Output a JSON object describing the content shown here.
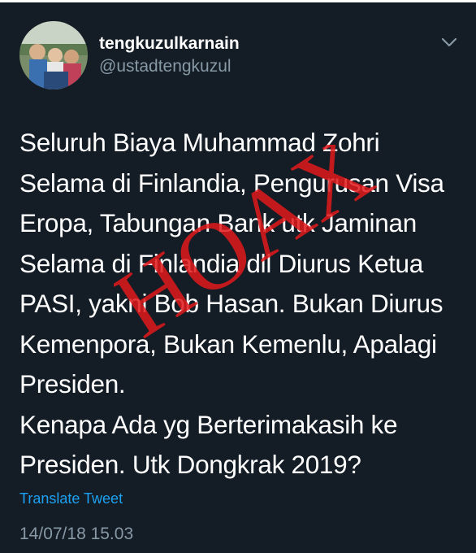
{
  "tweet": {
    "display_name": "tengkuzulkarnain",
    "handle": "@ustadtengkuzul",
    "body": "Seluruh Biaya Muhammad Zohri\nSelama di Finlandia, Pengurusan Visa\nEropa, Tabungan Bank utk Jaminan\nSelama di Finlandia dll Diurus Ketua\nPASI, yakni Bob Hasan. Bukan Diurus\nKemenpora, Bukan Kemenlu, Apalagi\nPresiden.\nKenapa Ada yg Berterimakasih ke\nPresiden. Utk Dongkrak 2019?",
    "translate_label": "Translate Tweet",
    "timestamp": "14/07/18 15.03"
  },
  "overlay": {
    "stamp_text": "HOAX",
    "stamp_color": "#e0191b"
  },
  "icons": {
    "menu": "chevron-down-icon",
    "avatar": "profile-photo"
  },
  "colors": {
    "background": "#141d26",
    "secondary_text": "#8899a6",
    "link": "#1da1f2"
  }
}
